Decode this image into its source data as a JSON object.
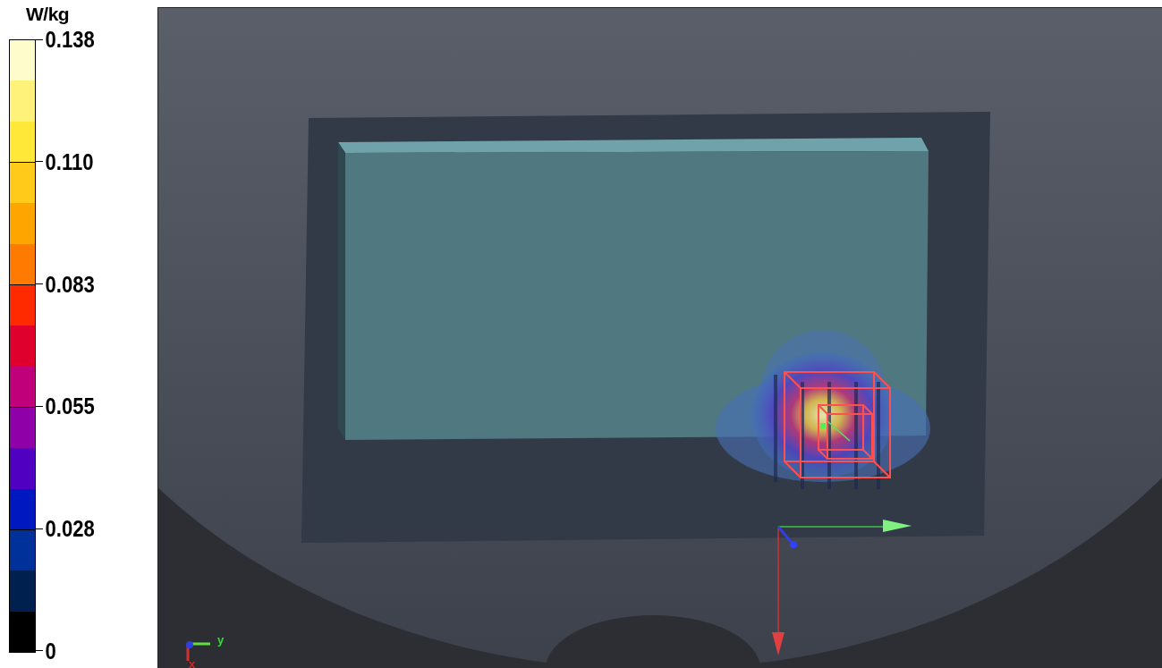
{
  "legend": {
    "unit": "W/kg",
    "ticks": [
      "0.138",
      "0.110",
      "0.083",
      "0.055",
      "0.028",
      "0"
    ],
    "bands": [
      {
        "color": "#fffccc"
      },
      {
        "color": "#fff27a"
      },
      {
        "color": "#ffe838"
      },
      {
        "color": "#ffca1a"
      },
      {
        "color": "#ffa500"
      },
      {
        "color": "#ff7a00"
      },
      {
        "color": "#ff2a00"
      },
      {
        "color": "#e0002e"
      },
      {
        "color": "#c0007a"
      },
      {
        "color": "#9000a8"
      },
      {
        "color": "#5000c0"
      },
      {
        "color": "#0018c0"
      },
      {
        "color": "#00309a"
      },
      {
        "color": "#002050"
      },
      {
        "color": "#000000"
      }
    ]
  },
  "viewport": {
    "triad_labels": [
      {
        "axis": "y",
        "color": "#30e030"
      },
      {
        "axis": "x",
        "color": "#e02020"
      }
    ]
  }
}
